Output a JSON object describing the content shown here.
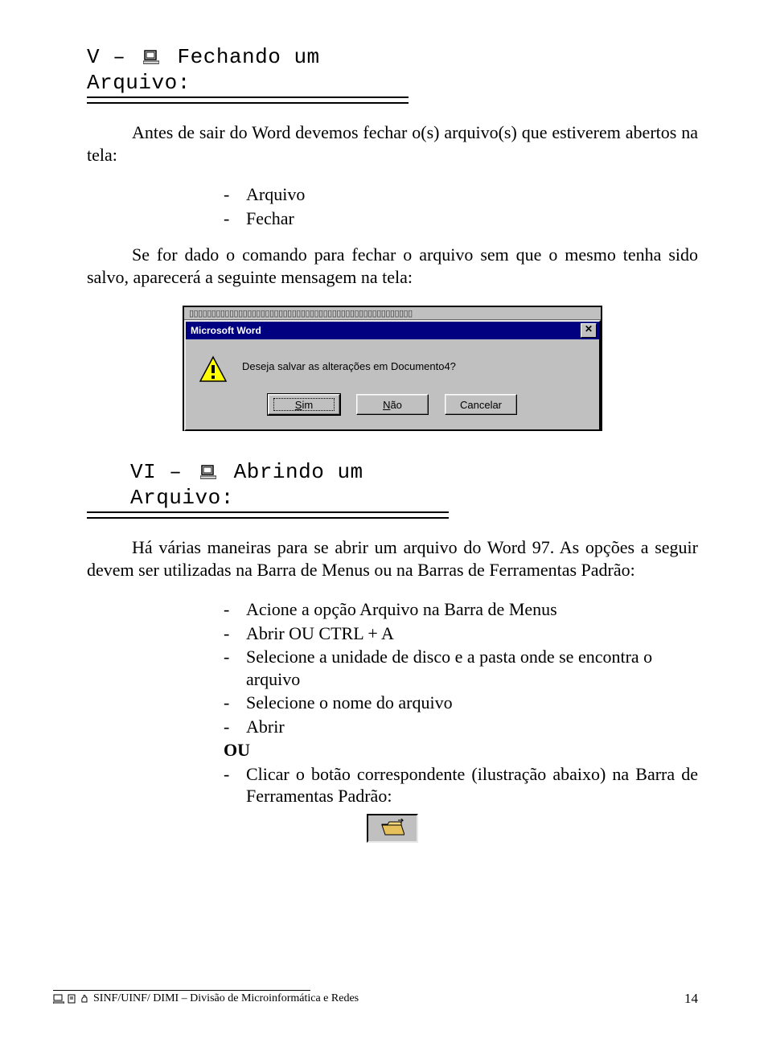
{
  "section5": {
    "heading_prefix": "V – ",
    "heading_text": " Fechando um Arquivo:",
    "intro": "Antes de sair do Word devemos fechar o(s) arquivo(s) que estiverem abertos na tela:",
    "steps": [
      "Arquivo",
      "Fechar"
    ],
    "intro2": "Se for dado o comando para fechar o arquivo sem que o mesmo tenha sido salvo, aparecerá a seguinte mensagem na tela:"
  },
  "dialog": {
    "title": "Microsoft Word",
    "close_icon_char": "✕",
    "message": "Deseja salvar as alterações em Documento4?",
    "buttons": {
      "yes": {
        "label": "Sim",
        "accel": "S",
        "rest": "im"
      },
      "no": {
        "label": "Não",
        "accel": "N",
        "rest": "ão"
      },
      "cancel": {
        "label": "Cancelar",
        "plain": "Cancelar"
      }
    }
  },
  "section6": {
    "heading_prefix": "VI – ",
    "heading_text": " Abrindo um Arquivo:",
    "intro": "Há várias maneiras para se abrir um arquivo do Word 97. As opções a seguir devem ser utilizadas na Barra de Menus ou na Barras de Ferramentas Padrão:",
    "steps": [
      "Acione a opção Arquivo na Barra de Menus",
      "Abrir  OU  CTRL + A",
      "Selecione a unidade de disco e a pasta onde se encontra o arquivo",
      "Selecione o nome do arquivo",
      "Abrir"
    ],
    "or": "OU",
    "last": "Clicar o botão correspondente (ilustração abaixo) na Barra de Ferramentas Padrão:"
  },
  "footer": {
    "text": " SINF/UINF/ DIMI – Divisão de Microinformática e Redes",
    "page": "14"
  }
}
